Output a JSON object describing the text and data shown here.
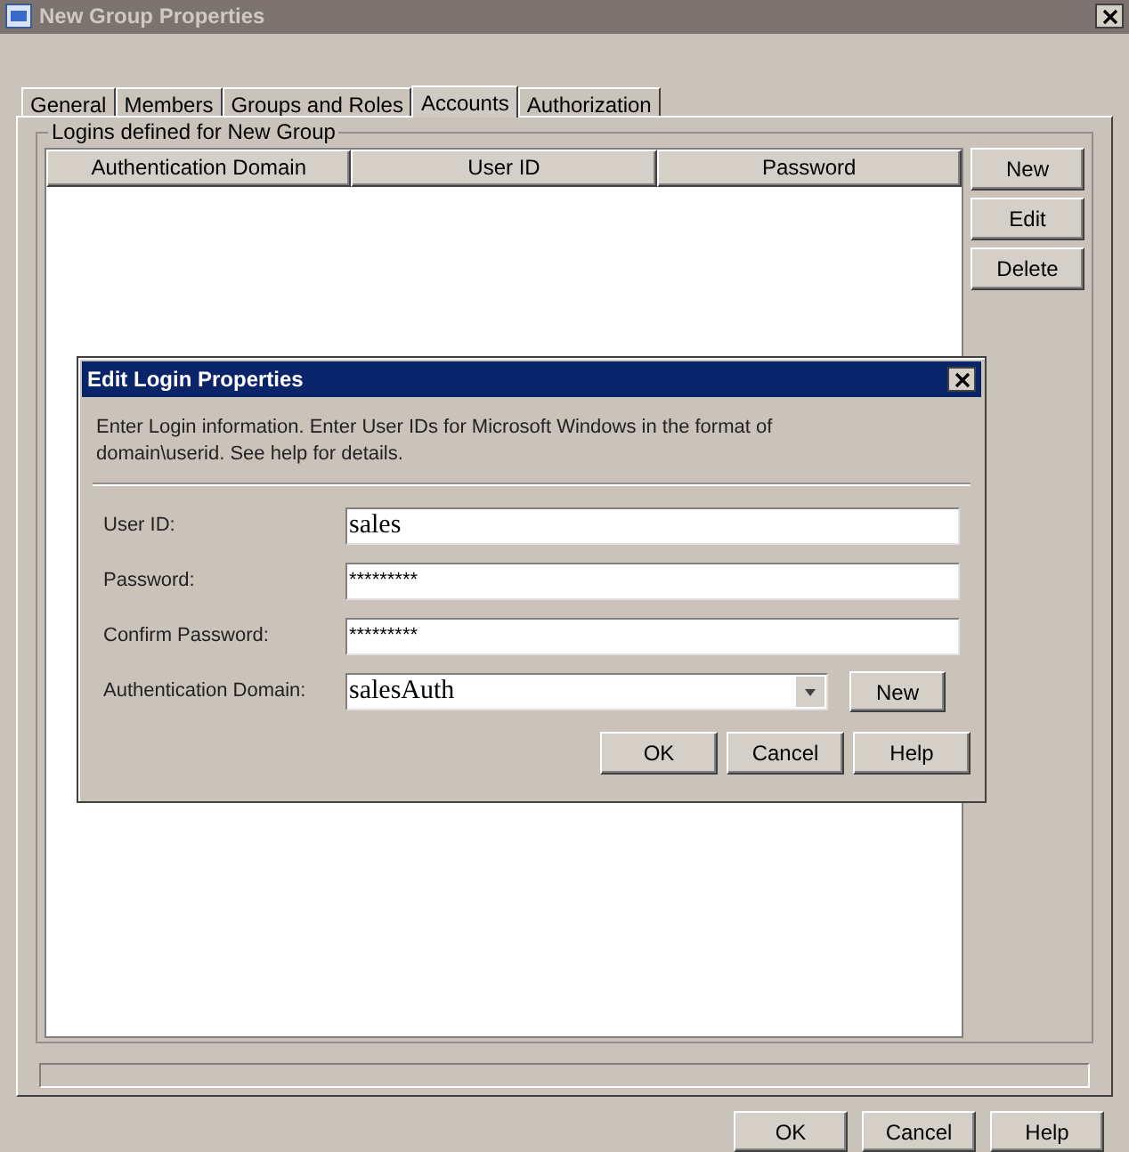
{
  "window": {
    "title": "New Group Properties"
  },
  "tabs": [
    {
      "label": "General",
      "selected": false
    },
    {
      "label": "Members",
      "selected": false
    },
    {
      "label": "Groups and Roles",
      "selected": false
    },
    {
      "label": "Accounts",
      "selected": true
    },
    {
      "label": "Authorization",
      "selected": false
    }
  ],
  "group": {
    "title": "Logins defined for New Group"
  },
  "table": {
    "columns": [
      "Authentication Domain",
      "User ID",
      "Password"
    ]
  },
  "side_buttons": [
    "New",
    "Edit",
    "Delete"
  ],
  "buttons": [
    "OK",
    "Cancel",
    "Help"
  ],
  "dialog": {
    "title": "Edit Login Properties",
    "message": "Enter Login information. Enter User IDs for Microsoft Windows in the format of domain\\userid. See help for details.",
    "fields": [
      {
        "kind": "text",
        "label": "User ID:",
        "value": "sales"
      },
      {
        "kind": "password",
        "label": "Password:",
        "value": "*********"
      },
      {
        "kind": "password",
        "label": "Confirm Password:",
        "value": "*********"
      },
      {
        "kind": "select",
        "label": "Authentication Domain:",
        "value": "salesAuth",
        "button": "New"
      }
    ],
    "buttons": [
      "OK",
      "Cancel",
      "Help"
    ]
  }
}
